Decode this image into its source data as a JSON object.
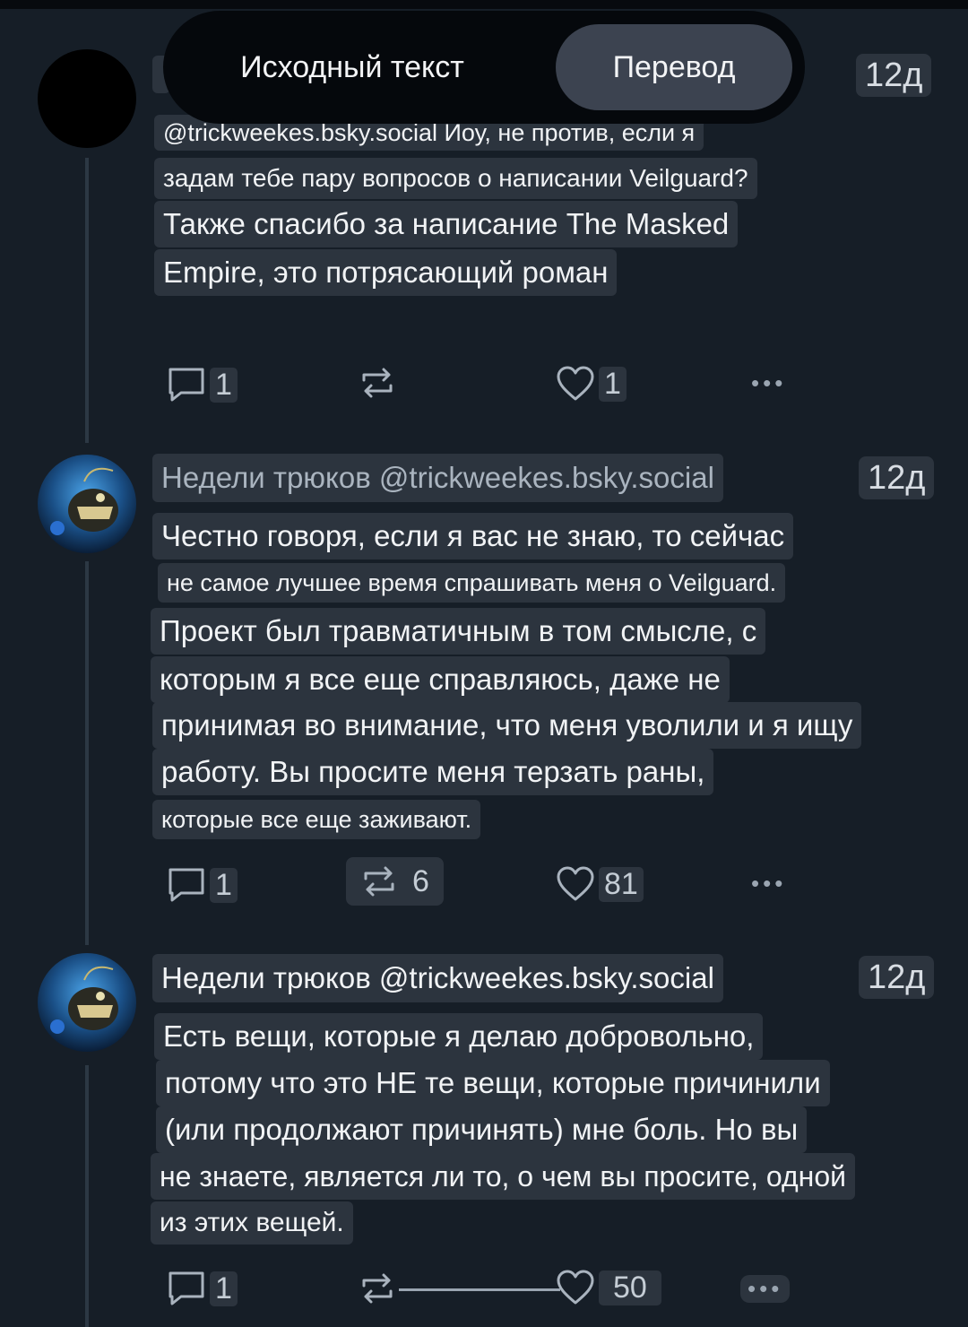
{
  "toggle": {
    "original_label": "Исходный текст",
    "translation_label": "Перевод"
  },
  "posts": [
    {
      "time": "12д",
      "lines": [
        "@trickweekes.bsky.social Йоу, не против, если я",
        "задам тебе пару вопросов о написании Veilguard?",
        "Также спасибо за написание The Masked",
        "Empire, это потрясающий роман"
      ],
      "replies": "1",
      "likes": "1"
    },
    {
      "author": "Недели трюков @trickweekes.bsky.social",
      "time": "12д",
      "lines": [
        "Честно говоря, если я вас не знаю, то сейчас",
        "не самое лучшее время спрашивать меня о Veilguard.",
        "Проект был травматичным в том смысле, с",
        "которым я все еще справляюсь, даже не",
        "принимая во внимание, что меня уволили и я ищу",
        "работу. Вы просите меня терзать раны,",
        "которые все еще заживают."
      ],
      "replies": "1",
      "reposts": "6",
      "likes": "81"
    },
    {
      "author": "Недели трюков @trickweekes.bsky.social",
      "time": "12д",
      "lines": [
        "Есть вещи, которые я делаю добровольно,",
        "потому что это НЕ те вещи, которые причинили",
        "(или продолжают причинять) мне боль. Но вы",
        "не знаете, является ли то, о чем вы просите, одной",
        "из этих вещей."
      ],
      "replies": "1",
      "likes": "50"
    }
  ],
  "icons": {
    "reply": "speech-bubble-icon",
    "repost": "repost-arrows-icon",
    "like": "heart-icon",
    "more": "ellipsis-icon"
  },
  "colors": {
    "background": "#161e27",
    "highlight": "#2c343e",
    "toggle_active": "#3c4350"
  }
}
